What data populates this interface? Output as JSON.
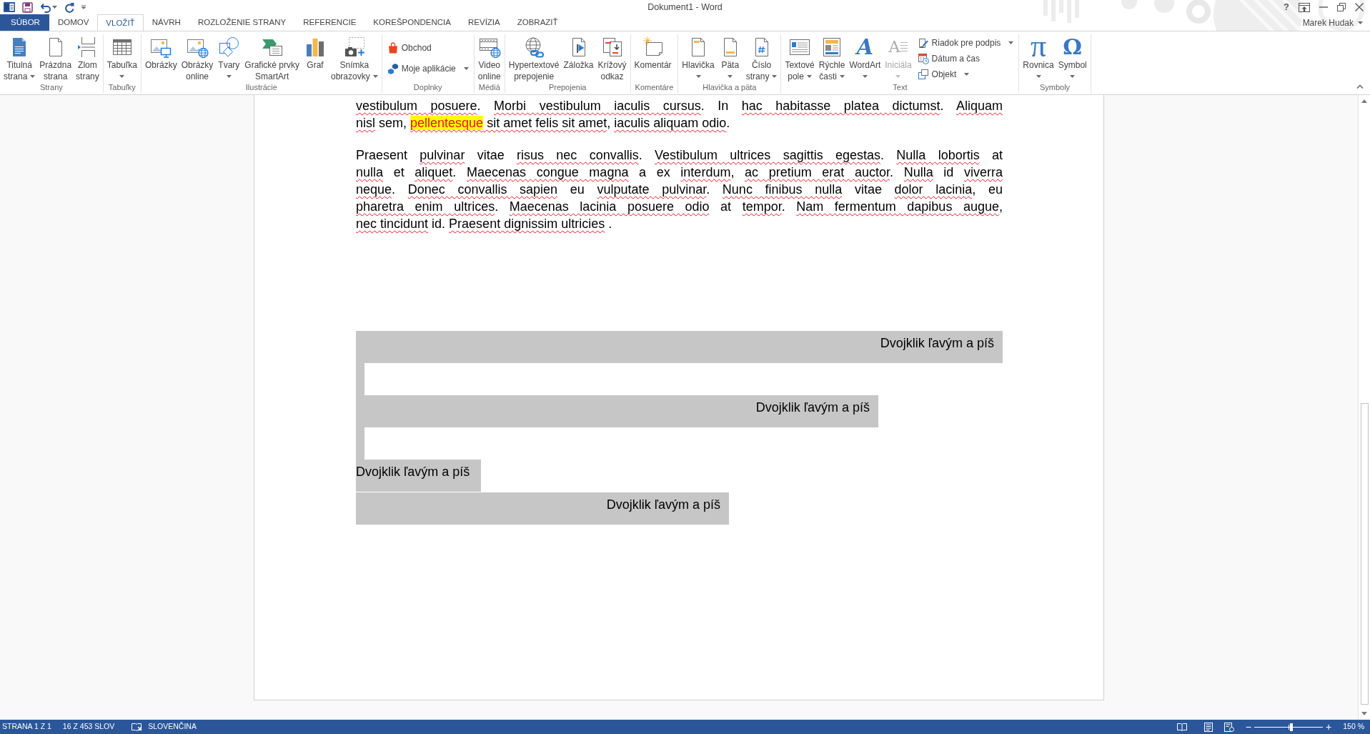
{
  "title_bar": {
    "title": "Dokument1 - Word",
    "help": "?"
  },
  "tabs": [
    {
      "label": "SÚBOR",
      "kind": "file",
      "selected": false
    },
    {
      "label": "DOMOV",
      "kind": "tab",
      "selected": false
    },
    {
      "label": "VLOŽIŤ",
      "kind": "tab",
      "selected": true
    },
    {
      "label": "NÁVRH",
      "kind": "tab",
      "selected": false
    },
    {
      "label": "ROZLOŽENIE STRANY",
      "kind": "tab",
      "selected": false
    },
    {
      "label": "REFERENCIE",
      "kind": "tab",
      "selected": false
    },
    {
      "label": "KOREŠPONDENCIA",
      "kind": "tab",
      "selected": false
    },
    {
      "label": "REVÍZIA",
      "kind": "tab",
      "selected": false
    },
    {
      "label": "ZOBRAZIŤ",
      "kind": "tab",
      "selected": false
    }
  ],
  "account": {
    "user": "Marek Hudak"
  },
  "ribbon": {
    "groups": [
      {
        "label": "Strany",
        "buttons": [
          {
            "kind": "large",
            "lines": [
              "Titulná",
              "strana"
            ],
            "dropdown": true
          },
          {
            "kind": "large",
            "lines": [
              "Prázdna",
              "strana"
            ],
            "dropdown": false
          },
          {
            "kind": "large",
            "lines": [
              "Zlom",
              "strany"
            ],
            "dropdown": false
          }
        ]
      },
      {
        "label": "Tabuľky",
        "buttons": [
          {
            "kind": "large",
            "lines": [
              "Tabuľka"
            ],
            "dropdown": true
          }
        ]
      },
      {
        "label": "Ilustrácie",
        "buttons": [
          {
            "kind": "large",
            "lines": [
              "Obrázky"
            ],
            "dropdown": false
          },
          {
            "kind": "large",
            "lines": [
              "Obrázky",
              "online"
            ],
            "dropdown": false
          },
          {
            "kind": "large",
            "lines": [
              "Tvary"
            ],
            "dropdown": true
          },
          {
            "kind": "large",
            "lines": [
              "Grafické prvky",
              "SmartArt"
            ],
            "dropdown": false
          },
          {
            "kind": "large",
            "lines": [
              "Graf"
            ],
            "dropdown": false
          },
          {
            "kind": "large",
            "lines": [
              "Snímka",
              "obrazovky"
            ],
            "dropdown": true
          }
        ]
      },
      {
        "label": "Doplnky",
        "buttons": [
          {
            "kind": "small",
            "label": "Obchod",
            "dropdown": false
          },
          {
            "kind": "small",
            "label": "Moje aplikácie",
            "dropdown": true
          }
        ]
      },
      {
        "label": "Médiá",
        "buttons": [
          {
            "kind": "large",
            "lines": [
              "Video",
              "online"
            ],
            "dropdown": false
          }
        ]
      },
      {
        "label": "Prepojenia",
        "buttons": [
          {
            "kind": "large",
            "lines": [
              "Hypertextové",
              "prepojenie"
            ],
            "dropdown": false
          },
          {
            "kind": "large",
            "lines": [
              "Záložka"
            ],
            "dropdown": false
          },
          {
            "kind": "large",
            "lines": [
              "Krížový",
              "odkaz"
            ],
            "dropdown": false
          }
        ]
      },
      {
        "label": "Komentáre",
        "buttons": [
          {
            "kind": "large",
            "lines": [
              "Komentár"
            ],
            "dropdown": false
          }
        ]
      },
      {
        "label": "Hlavička a päta",
        "buttons": [
          {
            "kind": "large",
            "lines": [
              "Hlavička"
            ],
            "dropdown": true
          },
          {
            "kind": "large",
            "lines": [
              "Päta"
            ],
            "dropdown": true
          },
          {
            "kind": "large",
            "lines": [
              "Číslo",
              "strany"
            ],
            "dropdown": true
          }
        ]
      },
      {
        "label": "Text",
        "buttons": [
          {
            "kind": "large",
            "lines": [
              "Textové",
              "pole"
            ],
            "dropdown": true,
            "disabled": false
          },
          {
            "kind": "large",
            "lines": [
              "Rýchle",
              "časti"
            ],
            "dropdown": true,
            "disabled": false
          },
          {
            "kind": "large",
            "lines": [
              "WordArt"
            ],
            "dropdown": true,
            "disabled": false,
            "glyph": "A"
          },
          {
            "kind": "large",
            "lines": [
              "Iniciála"
            ],
            "dropdown": true,
            "disabled": true,
            "glyph": "A"
          },
          {
            "kind": "small",
            "label": "Riadok pre podpis",
            "dropdown": true,
            "disabled": false
          },
          {
            "kind": "small",
            "label": "Dátum a čas",
            "dropdown": false,
            "disabled": false
          },
          {
            "kind": "small",
            "label": "Objekt",
            "dropdown": true,
            "disabled": false
          }
        ]
      },
      {
        "label": "Symboly",
        "buttons": [
          {
            "kind": "large",
            "lines": [
              "Rovnica"
            ],
            "dropdown": true,
            "glyph": "π"
          },
          {
            "kind": "large",
            "lines": [
              "Symbol"
            ],
            "dropdown": true,
            "glyph": "Ω"
          }
        ]
      }
    ]
  },
  "document": {
    "paragraphs": [
      {
        "lines": [
          [
            {
              "kind": "misspelled",
              "text": "vestibulum posuere"
            },
            {
              "kind": "plain",
              "text": ". "
            },
            {
              "kind": "misspelled",
              "text": "Morbi vestibulum iaculis cursus"
            },
            {
              "kind": "plain",
              "text": ". In "
            },
            {
              "kind": "misspelled",
              "text": "hac habitasse platea dictumst"
            },
            {
              "kind": "plain",
              "text": ". "
            },
            {
              "kind": "misspelled",
              "text": "Aliquam"
            }
          ],
          [
            {
              "kind": "misspelled",
              "text": "nisl"
            },
            {
              "kind": "plain",
              "text": " sem, "
            },
            {
              "kind": "highlighted",
              "text": "pellentesque"
            },
            {
              "kind": "misspelled",
              "text": " sit amet felis sit amet"
            },
            {
              "kind": "plain",
              "text": ", "
            },
            {
              "kind": "misspelled",
              "text": "iaculis aliquam odio"
            },
            {
              "kind": "plain",
              "text": "."
            }
          ]
        ]
      },
      {
        "lines": [
          [
            {
              "kind": "plain",
              "text": "Praesent "
            },
            {
              "kind": "misspelled",
              "text": "pulvinar"
            },
            {
              "kind": "plain",
              "text": " vitae "
            },
            {
              "kind": "misspelled",
              "text": "risus nec convallis"
            },
            {
              "kind": "plain",
              "text": ". "
            },
            {
              "kind": "misspelled",
              "text": "Vestibulum ultrices sagittis egestas"
            },
            {
              "kind": "plain",
              "text": ". "
            },
            {
              "kind": "misspelled",
              "text": "Nulla lobortis"
            },
            {
              "kind": "plain",
              "text": " at"
            }
          ],
          [
            {
              "kind": "misspelled",
              "text": "nulla"
            },
            {
              "kind": "plain",
              "text": " et "
            },
            {
              "kind": "misspelled",
              "text": "aliquet"
            },
            {
              "kind": "plain",
              "text": ". "
            },
            {
              "kind": "misspelled",
              "text": "Maecenas congue magna"
            },
            {
              "kind": "plain",
              "text": " a ex "
            },
            {
              "kind": "misspelled",
              "text": "interdum"
            },
            {
              "kind": "plain",
              "text": ", "
            },
            {
              "kind": "misspelled",
              "text": "ac pretium erat auctor"
            },
            {
              "kind": "plain",
              "text": ". "
            },
            {
              "kind": "misspelled",
              "text": "Nulla"
            },
            {
              "kind": "plain",
              "text": " id "
            },
            {
              "kind": "misspelled",
              "text": "viverra"
            }
          ],
          [
            {
              "kind": "misspelled",
              "text": "neque"
            },
            {
              "kind": "plain",
              "text": ". "
            },
            {
              "kind": "misspelled",
              "text": "Donec convallis sapien"
            },
            {
              "kind": "plain",
              "text": " eu "
            },
            {
              "kind": "misspelled",
              "text": "vulputate pulvinar"
            },
            {
              "kind": "plain",
              "text": ". "
            },
            {
              "kind": "misspelled",
              "text": "Nunc finibus nulla"
            },
            {
              "kind": "plain",
              "text": " vitae "
            },
            {
              "kind": "misspelled",
              "text": "dolor lacinia"
            },
            {
              "kind": "plain",
              "text": ", eu"
            }
          ],
          [
            {
              "kind": "misspelled",
              "text": "pharetra enim ultrices"
            },
            {
              "kind": "plain",
              "text": ". "
            },
            {
              "kind": "misspelled",
              "text": "Maecenas lacinia posuere odio"
            },
            {
              "kind": "plain",
              "text": " at "
            },
            {
              "kind": "misspelled",
              "text": "tempor"
            },
            {
              "kind": "plain",
              "text": ". "
            },
            {
              "kind": "misspelled",
              "text": "Nam fermentum dapibus augue"
            },
            {
              "kind": "plain",
              "text": ","
            }
          ],
          [
            {
              "kind": "misspelled",
              "text": "nec tincidunt"
            },
            {
              "kind": "plain",
              "text": " id. "
            },
            {
              "kind": "misspelled",
              "text": "Praesent dignissim ultricies"
            },
            {
              "kind": "plain",
              "text": " ."
            }
          ]
        ]
      }
    ],
    "content_controls": [
      {
        "text": "Dvojklik ľavým a píš"
      },
      {
        "text": "Dvojklik ľavým a píš"
      },
      {
        "text": "Dvojklik ľavým a píš"
      },
      {
        "text": "Dvojklik ľavým a píš"
      }
    ]
  },
  "status_bar": {
    "page": "STRANA 1 Z 1",
    "words": "16 Z 453 SLOV",
    "language": "SLOVENČINA",
    "zoom_out": "−",
    "zoom_slider": {
      "level": 0.54
    },
    "zoom_in": "+",
    "zoom": "150 %"
  }
}
